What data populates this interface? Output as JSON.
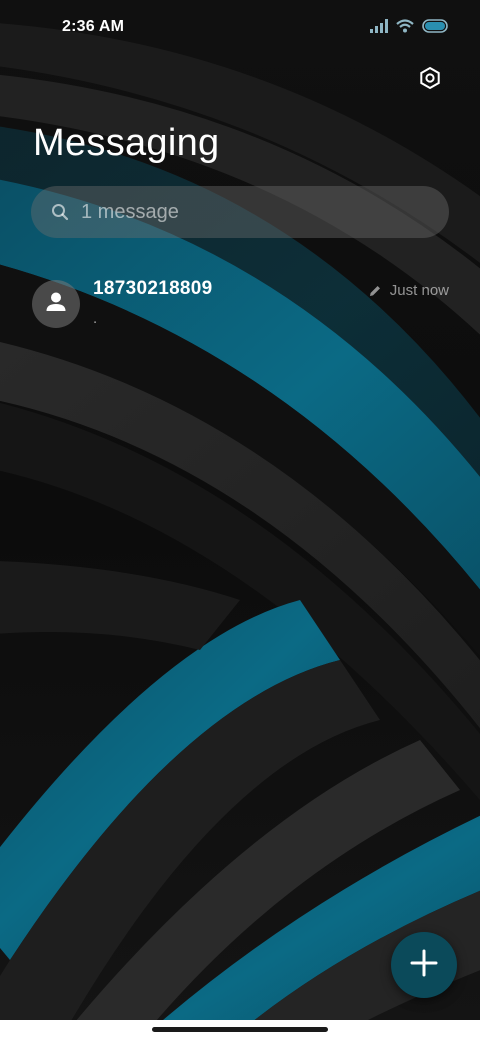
{
  "status_bar": {
    "time": "2:36 AM",
    "icons": [
      "signal-icon",
      "wifi-icon",
      "battery-icon"
    ]
  },
  "header": {
    "title": "Messaging",
    "settings_icon": "gear-icon"
  },
  "search": {
    "icon": "search-icon",
    "placeholder": "1 message"
  },
  "conversations": [
    {
      "sender": "18730218809",
      "preview": ".",
      "timestamp": "Just now",
      "draft_icon": "pencil-icon",
      "avatar_icon": "person-icon"
    }
  ],
  "fab": {
    "icon": "plus-icon"
  },
  "colors": {
    "accent": "#0b4a5a",
    "wallpaper_teal": "#0a5f78"
  }
}
